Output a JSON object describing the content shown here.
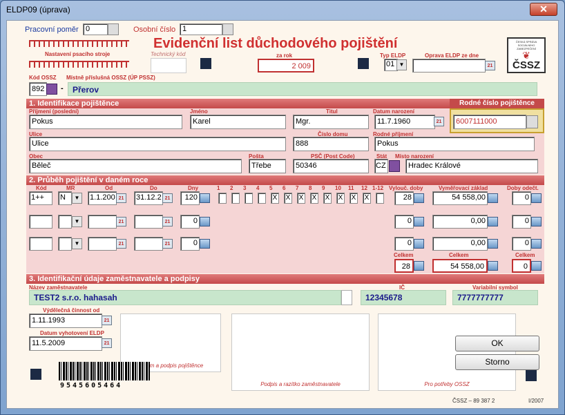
{
  "window": {
    "title": "ELDP09 (úprava)",
    "close": "✕"
  },
  "top": {
    "pracovni_pomer_label": "Pracovní poměr",
    "pracovni_pomer_value": "0",
    "osobni_cislo_label": "Osobní číslo",
    "osobni_cislo_value": "1",
    "nastaveni_tiskarny": "Nastavení psacího stroje",
    "technicky_kod": "Technický kód",
    "title": "Evidenční list důchodového pojištění",
    "za_rok_label": "za rok",
    "za_rok_value": "2 009",
    "typ_eldp_label": "Typ ELDP",
    "typ_eldp_value": "01",
    "oprava_label": "Oprava ELDP ze dne",
    "oprava_value": "",
    "kod_ossz_label": "Kód OSSZ",
    "kod_ossz_value": "892",
    "mistne_label": "Místně příslušná OSSZ (ÚP PSSZ)",
    "mistne_value": "Přerov",
    "logo_small": "ČESKÁ SPRÁVA SOCIÁLNÍHO ZABEZPEČENÍ",
    "logo_text": "ČSSZ",
    "dash": "-"
  },
  "sec1": {
    "header": "1. Identifikace pojištěnce",
    "rodne_header": "Rodné číslo pojištěnce",
    "prijmeni_label": "Příjmení (poslední)",
    "prijmeni": "Pokus",
    "jmeno_label": "Jméno",
    "jmeno": "Karel",
    "titul_label": "Titul",
    "titul": "Mgr.",
    "datum_label": "Datum narození",
    "datum": "11.7.1960",
    "rodne": "6007111000",
    "ulice_label": "Ulice",
    "ulice": "Ulice",
    "cislo_label": "Číslo domu",
    "cislo": "888",
    "rodne_prijmeni_label": "Rodné příjmení",
    "rodne_prijmeni": "Pokus",
    "obec_label": "Obec",
    "obec": "Běleč",
    "posta_label": "Pošta",
    "posta": "Třebe",
    "psc_label": "PSČ (Post Code)",
    "psc": "50346",
    "stat_label": "Stát",
    "stat": "CZ",
    "misto_label": "Místo narození",
    "misto": "Hradec Králové"
  },
  "sec2": {
    "header": "2. Průběh pojištění v daném roce",
    "h_kod": "Kód",
    "h_mr": "MR",
    "h_od": "Od",
    "h_do": "Do",
    "h_dny": "Dny",
    "months": [
      "1",
      "2",
      "3",
      "4",
      "5",
      "6",
      "7",
      "8",
      "9",
      "10",
      "11",
      "12",
      "1-12"
    ],
    "h_vylouc": "Vylouč. doby",
    "h_vymer": "Vyměřovací základ",
    "h_doby": "Doby odečt.",
    "rows": [
      {
        "kod": "1++",
        "mr": "N",
        "od": "1.1.200",
        "do": "31.12.2",
        "dny": "120",
        "checks": [
          " ",
          " ",
          " ",
          " ",
          "X",
          "X",
          "X",
          "X",
          "X",
          "X",
          "X",
          "X"
        ],
        "vylouc": "28",
        "vymer": "54 558,00",
        "doby": "0"
      },
      {
        "kod": "",
        "mr": "",
        "od": "",
        "do": "",
        "dny": "0",
        "checks": [],
        "vylouc": "0",
        "vymer": "0,00",
        "doby": "0"
      },
      {
        "kod": "",
        "mr": "",
        "od": "",
        "do": "",
        "dny": "0",
        "checks": [],
        "vylouc": "0",
        "vymer": "0,00",
        "doby": "0"
      }
    ],
    "celkem_label": "Celkem",
    "celkem_vylouc": "28",
    "celkem_vymer": "54 558,00",
    "celkem_doby": "0"
  },
  "sec3": {
    "header": "3. Identifikační údaje zaměstnavatele a podpisy",
    "nazev_label": "Název zaměstnavatele",
    "nazev": "TEST2 s.r.o. hahasah",
    "ic_label": "IČ",
    "ic": "12345678",
    "vs_label": "Variabilní symbol",
    "vs": "7777777777",
    "vydelecna_label": "Výdělečná činnost od",
    "vydelecna": "1.11.1993",
    "vyhotoveni_label": "Datum vyhotovení ELDP",
    "vyhotoveni": "11.5.2009",
    "podpis_poj": "Datum a podpis pojištěnce",
    "podpis_zam": "Podpis a razítko zaměstnavatele",
    "potreby": "Pro potřeby OSSZ",
    "barcode": "9545605464",
    "ok": "OK",
    "storno": "Storno",
    "footer1": "ČSSZ – 89 387 2",
    "footer2": "I/2007"
  }
}
